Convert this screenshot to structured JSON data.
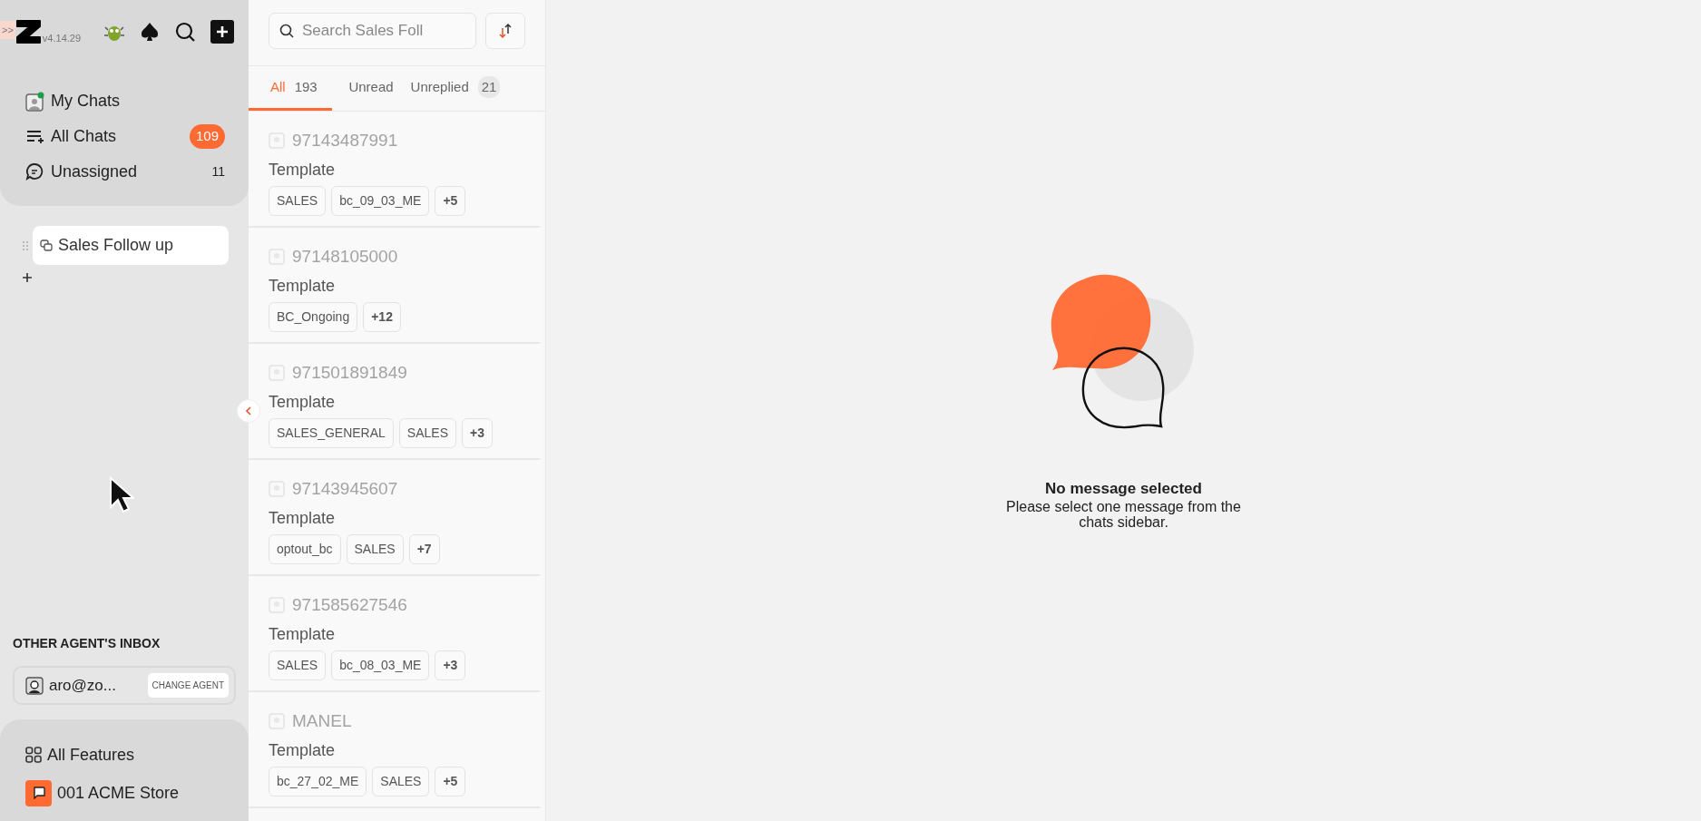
{
  "sidebar": {
    "expand_glyph": ">>",
    "version": "v4.14.29",
    "nav": [
      {
        "label": "My Chats",
        "kind": "user",
        "online": true
      },
      {
        "label": "All Chats",
        "kind": "list",
        "count": "109",
        "count_highlighted": true
      },
      {
        "label": "Unassigned",
        "kind": "unassigned",
        "count": "11",
        "count_highlighted": false
      }
    ],
    "folders": [
      {
        "label": "Sales Follow up",
        "selected": true
      }
    ],
    "other_inbox": {
      "heading": "OTHER AGENT'S INBOX",
      "agent": "aro@zo...",
      "button": "CHANGE AGENT"
    },
    "footer": [
      {
        "label": "All Features",
        "kind": "features"
      },
      {
        "label": "001 ACME Store",
        "kind": "store"
      }
    ]
  },
  "chat_list": {
    "search": {
      "placeholder": "Search Sales Foll"
    },
    "tabs": [
      {
        "label": "All",
        "count": "193",
        "selected": true
      },
      {
        "label": "Unread",
        "selected": false
      },
      {
        "label": "Unreplied",
        "count": "21",
        "selected": false
      }
    ],
    "chats": [
      {
        "name": "97143487991",
        "preview": "Template",
        "tags": [
          "SALES",
          "bc_09_03_ME",
          "+5"
        ]
      },
      {
        "name": "97148105000",
        "preview": "Template",
        "tags": [
          "BC_Ongoing",
          "+12"
        ]
      },
      {
        "name": "971501891849",
        "preview": "Template",
        "tags": [
          "SALES_GENERAL",
          "SALES",
          "+3"
        ]
      },
      {
        "name": "97143945607",
        "preview": "Template",
        "tags": [
          "optout_bc",
          "SALES",
          "+7"
        ]
      },
      {
        "name": "971585627546",
        "preview": "Template",
        "tags": [
          "SALES",
          "bc_08_03_ME",
          "+3"
        ]
      },
      {
        "name": "MANEL",
        "preview": "Template",
        "tags": [
          "bc_27_02_ME",
          "SALES",
          "+5"
        ]
      }
    ]
  },
  "empty_state": {
    "title": "No message selected",
    "text": "Please select one message from the chats sidebar."
  }
}
